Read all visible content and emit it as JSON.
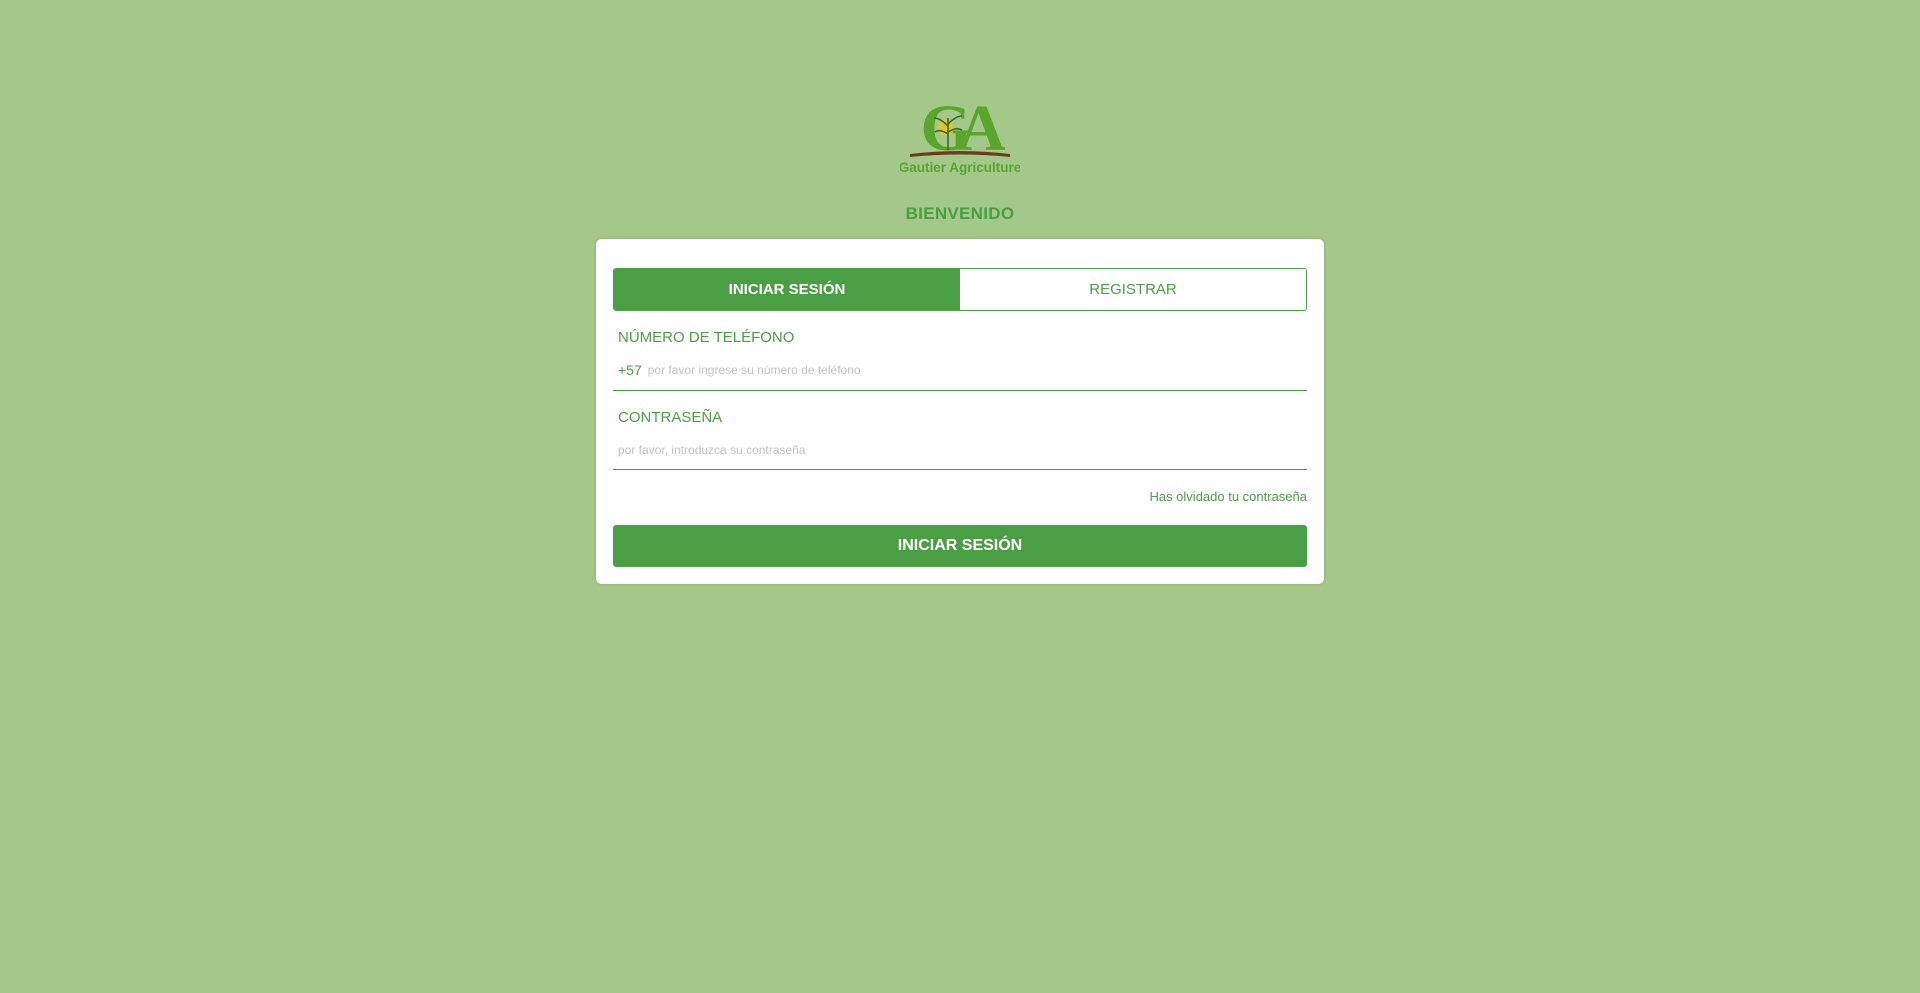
{
  "logo": {
    "monogram": "GA",
    "brand_text": "Gautier Agriculture"
  },
  "welcome": "BIENVENIDO",
  "tabs": [
    {
      "label": "INICIAR SESIÓN",
      "active": true
    },
    {
      "label": "REGISTRAR",
      "active": false
    }
  ],
  "phone": {
    "label": "NÚMERO DE TELÉFONO",
    "prefix": "+57",
    "placeholder": "por favor ingrese su número de teléfono",
    "value": ""
  },
  "password": {
    "label": "CONTRASEÑA",
    "placeholder": "por favor, introduzca su contraseña",
    "value": ""
  },
  "forgot_link": "Has olvidado tu contraseña",
  "submit_label": "INICIAR SESIÓN",
  "colors": {
    "background": "#a3c88a",
    "primary": "#4a9e44",
    "card": "#ffffff",
    "placeholder": "#c2c2c2"
  }
}
